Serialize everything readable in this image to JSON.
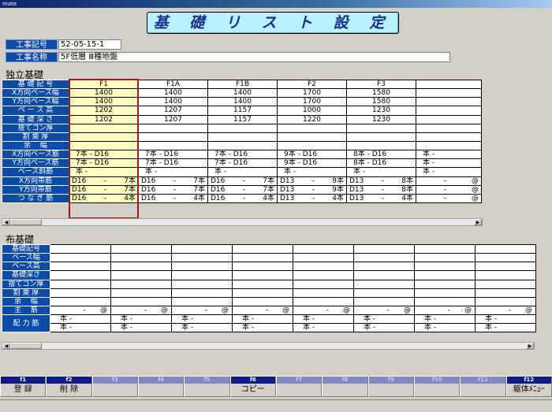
{
  "window": {
    "title": "mate"
  },
  "banner": {
    "title": "基 礎 リ ス ト 設 定"
  },
  "header": {
    "code_label": "工事記号",
    "code_value": "52-05-15-1",
    "name_label": "工事名称",
    "name_value": "5F低層 Ⅲ種地盤"
  },
  "isolated": {
    "title": "独立基礎",
    "row_labels": [
      "基 礎 記 号",
      "X方向ベース幅",
      "Y方向ベース幅",
      "ベ ー ス 高",
      "基 礎 深 さ",
      "捨てコン厚",
      "割 栗 厚",
      "余　 幅",
      "X方向ベース筋",
      "Y方向ベース筋",
      "ベース斜筋",
      "X方向帯筋",
      "Y方向帯筋",
      "つ な ぎ 筋"
    ],
    "columns": [
      "F1",
      "F1A",
      "F1B",
      "F2",
      "F3",
      ""
    ],
    "values": [
      [
        "1400",
        "1400",
        "1400",
        "1700",
        "1580",
        ""
      ],
      [
        "1400",
        "1400",
        "1400",
        "1700",
        "1580",
        ""
      ],
      [
        "1202",
        "1207",
        "1157",
        "1000",
        "1230",
        ""
      ],
      [
        "1202",
        "1207",
        "1157",
        "1220",
        "1230",
        ""
      ],
      [
        "",
        "",
        "",
        "",
        "",
        ""
      ],
      [
        "",
        "",
        "",
        "",
        "",
        ""
      ],
      [
        "",
        "",
        "",
        "",
        "",
        ""
      ],
      [
        "7本 - D16",
        "7本 - D16",
        "7本 - D16",
        "9本 - D16",
        "8本 - D16",
        "本 -"
      ],
      [
        "7本 - D16",
        "7本 - D16",
        "7本 - D16",
        "9本 - D16",
        "8本 - D16",
        "本 -"
      ],
      [
        "本 -",
        "本 -",
        "本 -",
        "本 -",
        "本 -",
        "本 -"
      ]
    ],
    "ties": [
      [
        [
          "D16",
          "-",
          "7本"
        ],
        [
          "D16",
          "-",
          "7本"
        ],
        [
          "D16",
          "-",
          "7本"
        ],
        [
          "D13",
          "-",
          "9本"
        ],
        [
          "D13",
          "-",
          "8本"
        ],
        [
          "",
          "-",
          "@"
        ]
      ],
      [
        [
          "D16",
          "-",
          "7本"
        ],
        [
          "D16",
          "-",
          "7本"
        ],
        [
          "D16",
          "-",
          "7本"
        ],
        [
          "D13",
          "-",
          "9本"
        ],
        [
          "D13",
          "-",
          "8本"
        ],
        [
          "",
          "-",
          "@"
        ]
      ],
      [
        [
          "D16",
          "-",
          "4本"
        ],
        [
          "D16",
          "-",
          "4本"
        ],
        [
          "D16",
          "-",
          "4本"
        ],
        [
          "D13",
          "-",
          "4本"
        ],
        [
          "D13",
          "-",
          "4本"
        ],
        [
          "",
          "-",
          "@"
        ]
      ]
    ]
  },
  "strip": {
    "title": "布基礎",
    "row_labels": [
      "基礎記号",
      "ベース幅",
      "ベース高",
      "基礎深さ",
      "捨てコン厚",
      "割 栗 厚",
      "余　 幅",
      "主　 筋",
      "配 力 筋"
    ],
    "main_bar": [
      "-",
      "@"
    ],
    "dist_bar": [
      "本 -",
      "本 -"
    ]
  },
  "fkeys": [
    {
      "fn": "f1",
      "label": "登 録",
      "on": true
    },
    {
      "fn": "f2",
      "label": "削 除",
      "on": true
    },
    {
      "fn": "f3",
      "label": "",
      "on": false
    },
    {
      "fn": "f4",
      "label": "",
      "on": false
    },
    {
      "fn": "f5",
      "label": "",
      "on": false
    },
    {
      "fn": "f6",
      "label": "コピー",
      "on": true
    },
    {
      "fn": "f7",
      "label": "",
      "on": false
    },
    {
      "fn": "f8",
      "label": "",
      "on": false
    },
    {
      "fn": "f9",
      "label": "",
      "on": false
    },
    {
      "fn": "f10",
      "label": "",
      "on": false
    },
    {
      "fn": "f11",
      "label": "",
      "on": false
    },
    {
      "fn": "f12",
      "label": "躯体ﾒﾆｭｰ",
      "on": true
    }
  ]
}
